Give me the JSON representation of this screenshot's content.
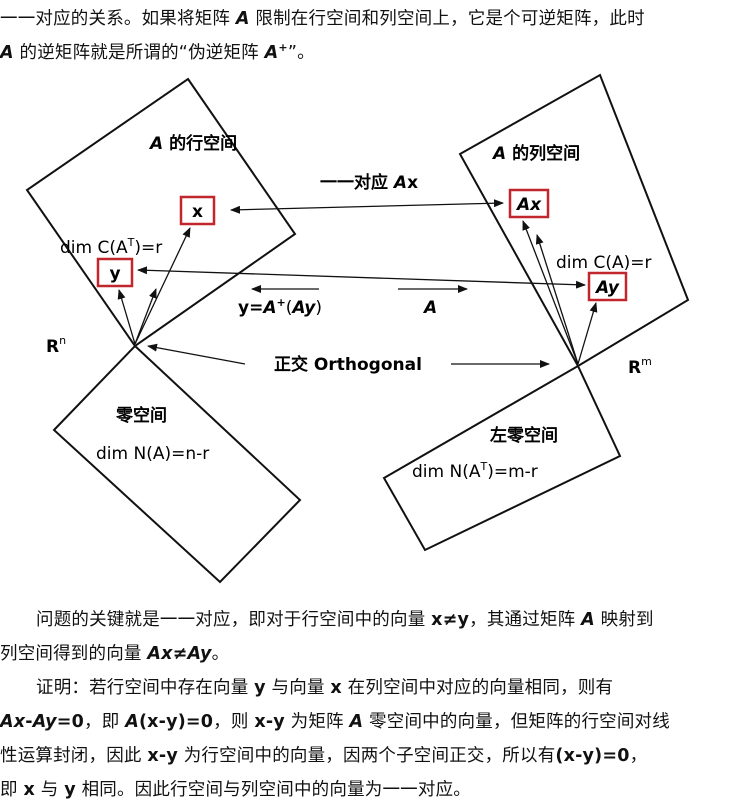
{
  "intro": {
    "line1_a": "一一对应的关系。如果将矩阵 ",
    "A": "A",
    "line1_b": " 限制在行空间和列空间上，它是个可逆矩阵，此时",
    "line2_a": " 的逆矩阵就是所谓的“伪逆矩阵 ",
    "plus": "+",
    "line2_b": "”。"
  },
  "diagram": {
    "row_space_title_rest": "的行空间",
    "col_space_title_rest": "的列空间",
    "null_space_title": "零空间",
    "left_null_title": "左零空间",
    "x": "x",
    "y": "y",
    "Ax": "Ax",
    "Ay": "Ay",
    "dim_row": "dim C(A",
    "dim_row_sup": "T",
    "dim_row_tail": ")=r",
    "dim_col": "dim C(A)=r",
    "dim_null": "dim N(A)=n-r",
    "dim_left_null": "dim N(A",
    "dim_left_null_sup": "T",
    "dim_left_null_tail": ")=m-r",
    "one_to_one_a": "一一对应 ",
    "one_to_one_b": "x",
    "pinv_label_a": "y=",
    "pinv_label_b": "(",
    "pinv_label_c": "Ay",
    "pinv_label_d": ")",
    "A_label": "A",
    "orth_label": "正交  Orthogonal",
    "Rn": "R",
    "Rn_sup": "n",
    "Rm": "R",
    "Rm_sup": "m"
  },
  "proof": {
    "p1_l1_a": "问题的关键就是一一对应，即对于行空间中的向量 ",
    "p1_l1_b": "x≠y",
    "p1_l1_c": "，其通过矩阵 ",
    "p1_l1_d": " 映射到",
    "p1_l2_a": "列空间得到的向量 ",
    "p1_l2_b": "Ax",
    "p1_l2_c": "≠",
    "p1_l2_d": "Ay",
    "p1_l2_e": "。",
    "p2_l1_a": "证明：若行空间中存在向量  ",
    "p2_l1_b": "y",
    "p2_l1_c": "  与向量  ",
    "p2_l1_d": "x",
    "p2_l1_e": "  在列空间中对应的向量相同，则有",
    "p2_l2_a": "Ax",
    "p2_l2_b": "-",
    "p2_l2_c": "Ay",
    "p2_l2_d": "=0",
    "p2_l2_e": "，即 ",
    "p2_l2_f": "(x-y)=0",
    "p2_l2_g": "，则 ",
    "p2_l2_h": "x-y",
    "p2_l2_i": " 为矩阵 ",
    "p2_l2_j": " 零空间中的向量，但矩阵的行空间对线",
    "p2_l3_a": "性运算封闭，因此  ",
    "p2_l3_b": "x-y",
    "p2_l3_c": "  为行空间中的向量，因两个子空间正交，所以有",
    "p2_l3_d": "(x-y)=0",
    "p2_l3_e": "，",
    "p2_l4_a": "即 ",
    "p2_l4_b": "x",
    "p2_l4_c": " 与 ",
    "p2_l4_d": "y",
    "p2_l4_e": " 相同。因此行空间与列空间中的向量为一一对应。"
  },
  "colors": {
    "box_red": "#c0262c",
    "ink": "#111111"
  }
}
